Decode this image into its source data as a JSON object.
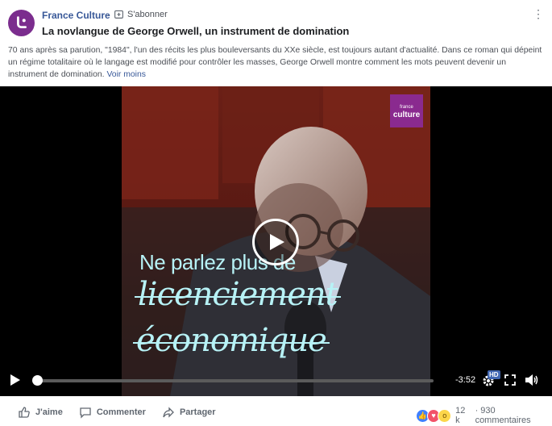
{
  "post": {
    "page_name": "France Culture",
    "separator": "·",
    "subscribe_label": "S'abonner",
    "title": "La novlangue de George Orwell, un instrument de domination",
    "description": "70 ans après sa parution, \"1984\", l'un des récits les plus bouleversants du XXe siècle, est toujours autant d'actualité. Dans ce roman qui dépeint un régime totalitaire où le langage est modifié pour contrôler les masses, George Orwell montre comment les mots peuvent devenir un instrument de domination.",
    "see_less": "Voir moins"
  },
  "video": {
    "logo_top": "france",
    "logo_bottom": "culture",
    "caption_line1": "Ne parlez plus de",
    "caption_line2": "licenciement",
    "caption_line3": "économique",
    "time_remaining": "-3:52",
    "hd_badge": "HD",
    "progress": 0.0
  },
  "footer": {
    "like_label": "J'aime",
    "comment_label": "Commenter",
    "share_label": "Partager",
    "reaction_count": "12 k",
    "comment_count": "· 930 commentaires"
  },
  "colors": {
    "link": "#385898",
    "avatar": "#7b2d8e",
    "caption": "#b7f2f6",
    "hd": "#4267b2"
  }
}
